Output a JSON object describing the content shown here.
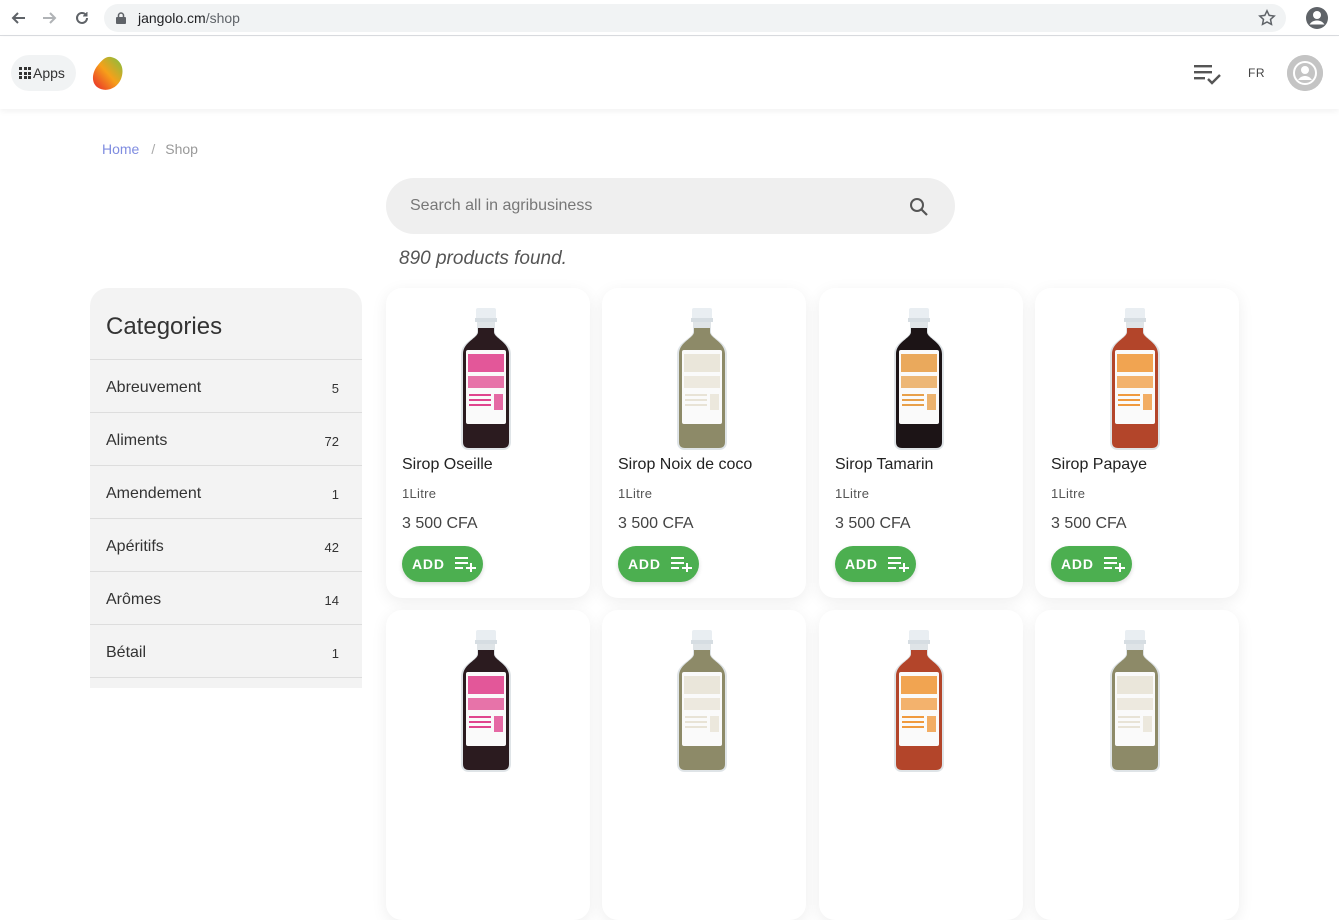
{
  "browser": {
    "url_host": "jangolo.cm",
    "url_path": "/shop"
  },
  "header": {
    "apps_label": "Apps",
    "lang": "FR"
  },
  "breadcrumb": {
    "home": "Home",
    "separator": "/",
    "current": "Shop"
  },
  "search": {
    "placeholder": "Search all in agribusiness"
  },
  "results": {
    "count_text": "890 products found."
  },
  "sidebar": {
    "title": "Categories",
    "items": [
      {
        "name": "Abreuvement",
        "count": "5"
      },
      {
        "name": "Aliments",
        "count": "72"
      },
      {
        "name": "Amendement",
        "count": "1"
      },
      {
        "name": "Apéritifs",
        "count": "42"
      },
      {
        "name": "Arômes",
        "count": "14"
      },
      {
        "name": "Bétail",
        "count": "1"
      }
    ]
  },
  "products": [
    {
      "name": "Sirop Oseille",
      "size": "1Litre",
      "price": "3 500 CFA",
      "add_label": "ADD",
      "liquid_color": "#2b1b1f",
      "label_color": "#e0458e",
      "label_text": "OSEILLE"
    },
    {
      "name": "Sirop Noix de coco",
      "size": "1Litre",
      "price": "3 500 CFA",
      "add_label": "ADD",
      "liquid_color": "#8d8a68",
      "label_color": "#e8e3d6",
      "label_text": "NOIX DE COCO"
    },
    {
      "name": "Sirop Tamarin",
      "size": "1Litre",
      "price": "3 500 CFA",
      "add_label": "ADD",
      "liquid_color": "#1c1416",
      "label_color": "#e8a04a",
      "label_text": "TAMARIN"
    },
    {
      "name": "Sirop Papaye",
      "size": "1Litre",
      "price": "3 500 CFA",
      "add_label": "ADD",
      "liquid_color": "#b3452a",
      "label_color": "#f09a3e",
      "label_text": "PAPAYE"
    }
  ],
  "colors": {
    "accent_green": "#4caf50",
    "link_blue": "#7f8ce0"
  }
}
